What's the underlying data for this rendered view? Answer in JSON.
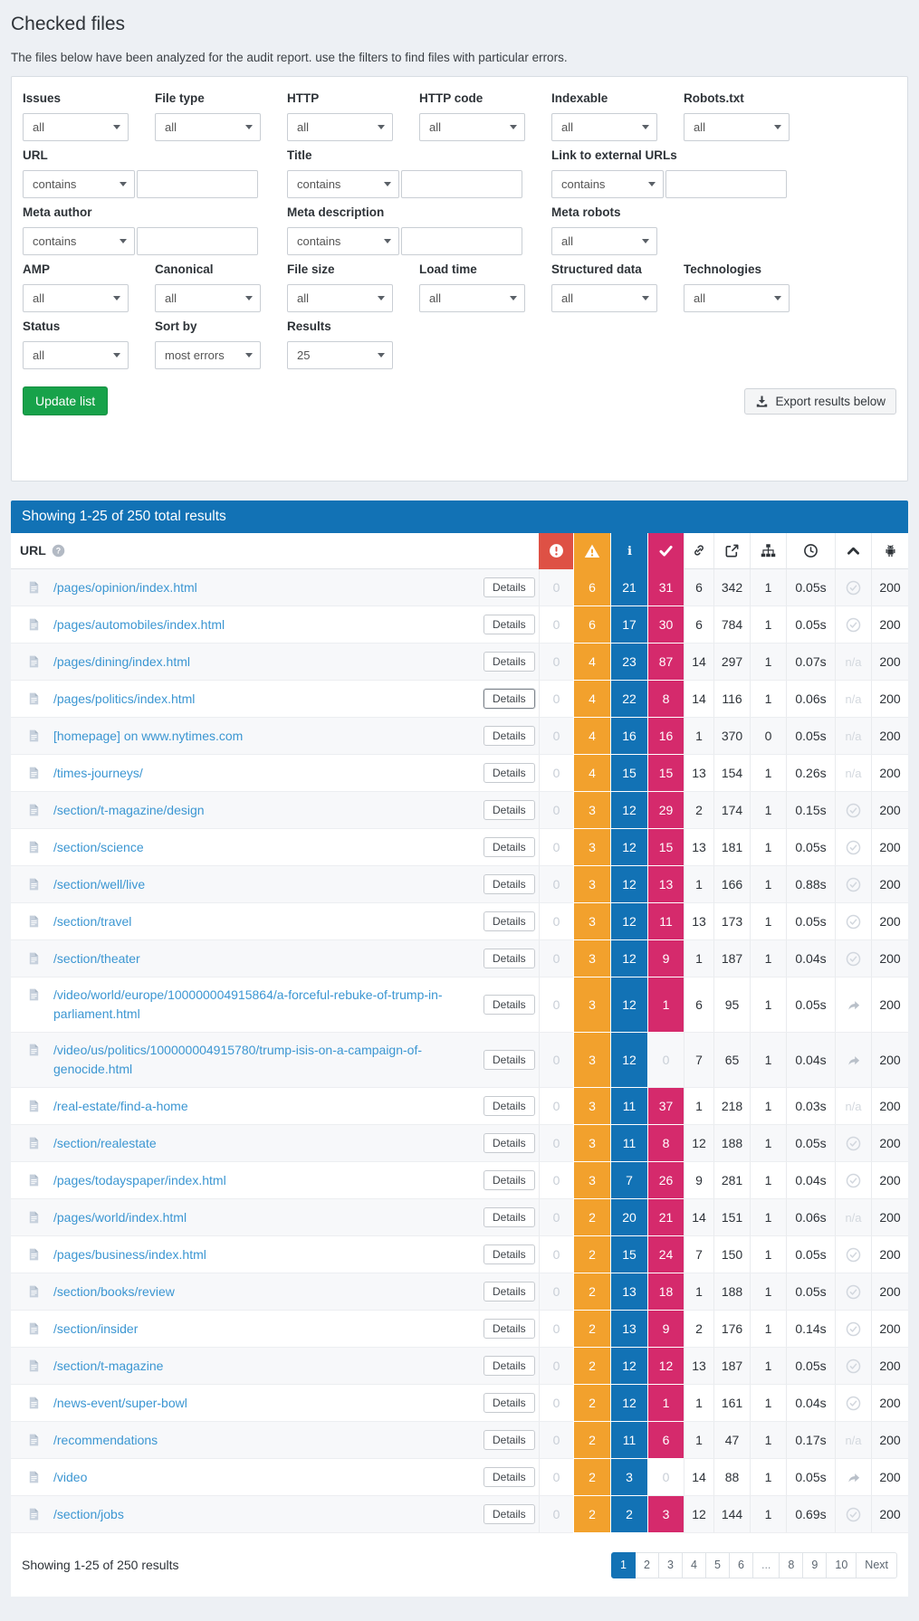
{
  "page": {
    "title": "Checked files",
    "subtitle": "The files below have been analyzed for the audit report. use the filters to find files with particular errors."
  },
  "filters": {
    "rows": [
      [
        {
          "kind": "select",
          "label": "Issues",
          "value": "all"
        },
        {
          "kind": "select",
          "label": "File type",
          "value": "all"
        },
        {
          "kind": "select",
          "label": "HTTP",
          "value": "all"
        },
        {
          "kind": "select",
          "label": "HTTP code",
          "value": "all"
        },
        {
          "kind": "select",
          "label": "Indexable",
          "value": "all"
        },
        {
          "kind": "select",
          "label": "Robots.txt",
          "value": "all"
        }
      ],
      [
        {
          "kind": "contains",
          "label": "URL",
          "value": "contains",
          "input": ""
        },
        {
          "kind": "contains",
          "label": "Title",
          "value": "contains",
          "input": ""
        },
        {
          "kind": "contains",
          "label": "Link to external URLs",
          "value": "contains",
          "input": ""
        }
      ],
      [
        {
          "kind": "contains",
          "label": "Meta author",
          "value": "contains",
          "input": ""
        },
        {
          "kind": "contains",
          "label": "Meta description",
          "value": "contains",
          "input": ""
        },
        {
          "kind": "select",
          "label": "Meta robots",
          "value": "all"
        }
      ],
      [
        {
          "kind": "select",
          "label": "AMP",
          "value": "all"
        },
        {
          "kind": "select",
          "label": "Canonical",
          "value": "all"
        },
        {
          "kind": "select",
          "label": "File size",
          "value": "all"
        },
        {
          "kind": "select",
          "label": "Load time",
          "value": "all"
        },
        {
          "kind": "select",
          "label": "Structured data",
          "value": "all"
        },
        {
          "kind": "select",
          "label": "Technologies",
          "value": "all"
        }
      ],
      [
        {
          "kind": "select",
          "label": "Status",
          "value": "all"
        },
        {
          "kind": "select",
          "label": "Sort by",
          "value": "most errors"
        },
        {
          "kind": "select",
          "label": "Results",
          "value": "25"
        }
      ]
    ]
  },
  "buttons": {
    "update": "Update list",
    "export": "Export results below"
  },
  "table": {
    "header_bar": "Showing 1-25 of 250 total results",
    "url_header": "URL",
    "details_label": "Details",
    "status_na": "n/a",
    "icon_columns": [
      "error",
      "warning",
      "info",
      "check",
      "links",
      "external-link",
      "sitemap",
      "load-time",
      "chevron-up",
      "android"
    ],
    "rows": [
      {
        "url": "/pages/opinion/index.html",
        "errors": 0,
        "warnings": 6,
        "info": 21,
        "check": 31,
        "links": 6,
        "external": 342,
        "sitemap": 1,
        "time": "0.05s",
        "status": "check",
        "code": 200
      },
      {
        "url": "/pages/automobiles/index.html",
        "errors": 0,
        "warnings": 6,
        "info": 17,
        "check": 30,
        "links": 6,
        "external": 784,
        "sitemap": 1,
        "time": "0.05s",
        "status": "check",
        "code": 200
      },
      {
        "url": "/pages/dining/index.html",
        "errors": 0,
        "warnings": 4,
        "info": 23,
        "check": 87,
        "links": 14,
        "external": 297,
        "sitemap": 1,
        "time": "0.07s",
        "status": "na",
        "code": 200
      },
      {
        "url": "/pages/politics/index.html",
        "errors": 0,
        "warnings": 4,
        "info": 22,
        "check": 8,
        "links": 14,
        "external": 116,
        "sitemap": 1,
        "time": "0.06s",
        "status": "na",
        "code": 200,
        "focused": true
      },
      {
        "url": "[homepage] on www.nytimes.com",
        "errors": 0,
        "warnings": 4,
        "info": 16,
        "check": 16,
        "links": 1,
        "external": 370,
        "sitemap": 0,
        "time": "0.05s",
        "status": "na",
        "code": 200
      },
      {
        "url": "/times-journeys/",
        "errors": 0,
        "warnings": 4,
        "info": 15,
        "check": 15,
        "links": 13,
        "external": 154,
        "sitemap": 1,
        "time": "0.26s",
        "status": "na",
        "code": 200
      },
      {
        "url": "/section/t-magazine/design",
        "errors": 0,
        "warnings": 3,
        "info": 12,
        "check": 29,
        "links": 2,
        "external": 174,
        "sitemap": 1,
        "time": "0.15s",
        "status": "check",
        "code": 200
      },
      {
        "url": "/section/science",
        "errors": 0,
        "warnings": 3,
        "info": 12,
        "check": 15,
        "links": 13,
        "external": 181,
        "sitemap": 1,
        "time": "0.05s",
        "status": "check",
        "code": 200
      },
      {
        "url": "/section/well/live",
        "errors": 0,
        "warnings": 3,
        "info": 12,
        "check": 13,
        "links": 1,
        "external": 166,
        "sitemap": 1,
        "time": "0.88s",
        "status": "check",
        "code": 200
      },
      {
        "url": "/section/travel",
        "errors": 0,
        "warnings": 3,
        "info": 12,
        "check": 11,
        "links": 13,
        "external": 173,
        "sitemap": 1,
        "time": "0.05s",
        "status": "check",
        "code": 200
      },
      {
        "url": "/section/theater",
        "errors": 0,
        "warnings": 3,
        "info": 12,
        "check": 9,
        "links": 1,
        "external": 187,
        "sitemap": 1,
        "time": "0.04s",
        "status": "check",
        "code": 200
      },
      {
        "url": "/video/world/europe/100000004915864/a-forceful-rebuke-of-trump-in-parliament.html",
        "errors": 0,
        "warnings": 3,
        "info": 12,
        "check": 1,
        "links": 6,
        "external": 95,
        "sitemap": 1,
        "time": "0.05s",
        "status": "redirect",
        "code": 200
      },
      {
        "url": "/video/us/politics/100000004915780/trump-isis-on-a-campaign-of-genocide.html",
        "errors": 0,
        "warnings": 3,
        "info": 12,
        "check": 0,
        "links": 7,
        "external": 65,
        "sitemap": 1,
        "time": "0.04s",
        "status": "redirect",
        "code": 200
      },
      {
        "url": "/real-estate/find-a-home",
        "errors": 0,
        "warnings": 3,
        "info": 11,
        "check": 37,
        "links": 1,
        "external": 218,
        "sitemap": 1,
        "time": "0.03s",
        "status": "na",
        "code": 200
      },
      {
        "url": "/section/realestate",
        "errors": 0,
        "warnings": 3,
        "info": 11,
        "check": 8,
        "links": 12,
        "external": 188,
        "sitemap": 1,
        "time": "0.05s",
        "status": "check",
        "code": 200
      },
      {
        "url": "/pages/todayspaper/index.html",
        "errors": 0,
        "warnings": 3,
        "info": 7,
        "check": 26,
        "links": 9,
        "external": 281,
        "sitemap": 1,
        "time": "0.04s",
        "status": "check",
        "code": 200
      },
      {
        "url": "/pages/world/index.html",
        "errors": 0,
        "warnings": 2,
        "info": 20,
        "check": 21,
        "links": 14,
        "external": 151,
        "sitemap": 1,
        "time": "0.06s",
        "status": "na",
        "code": 200
      },
      {
        "url": "/pages/business/index.html",
        "errors": 0,
        "warnings": 2,
        "info": 15,
        "check": 24,
        "links": 7,
        "external": 150,
        "sitemap": 1,
        "time": "0.05s",
        "status": "check",
        "code": 200
      },
      {
        "url": "/section/books/review",
        "errors": 0,
        "warnings": 2,
        "info": 13,
        "check": 18,
        "links": 1,
        "external": 188,
        "sitemap": 1,
        "time": "0.05s",
        "status": "check",
        "code": 200
      },
      {
        "url": "/section/insider",
        "errors": 0,
        "warnings": 2,
        "info": 13,
        "check": 9,
        "links": 2,
        "external": 176,
        "sitemap": 1,
        "time": "0.14s",
        "status": "check",
        "code": 200
      },
      {
        "url": "/section/t-magazine",
        "errors": 0,
        "warnings": 2,
        "info": 12,
        "check": 12,
        "links": 13,
        "external": 187,
        "sitemap": 1,
        "time": "0.05s",
        "status": "check",
        "code": 200
      },
      {
        "url": "/news-event/super-bowl",
        "errors": 0,
        "warnings": 2,
        "info": 12,
        "check": 1,
        "links": 1,
        "external": 161,
        "sitemap": 1,
        "time": "0.04s",
        "status": "check",
        "code": 200
      },
      {
        "url": "/recommendations",
        "errors": 0,
        "warnings": 2,
        "info": 11,
        "check": 6,
        "links": 1,
        "external": 47,
        "sitemap": 1,
        "time": "0.17s",
        "status": "na",
        "code": 200
      },
      {
        "url": "/video",
        "errors": 0,
        "warnings": 2,
        "info": 3,
        "check": 0,
        "links": 14,
        "external": 88,
        "sitemap": 1,
        "time": "0.05s",
        "status": "redirect",
        "code": 200
      },
      {
        "url": "/section/jobs",
        "errors": 0,
        "warnings": 2,
        "info": 2,
        "check": 3,
        "links": 12,
        "external": 144,
        "sitemap": 1,
        "time": "0.69s",
        "status": "check",
        "code": 200
      }
    ],
    "footer": "Showing 1-25 of 250 results",
    "pagination": [
      "1",
      "2",
      "3",
      "4",
      "5",
      "6",
      "...",
      "8",
      "9",
      "10",
      "Next"
    ],
    "active_page": "1"
  },
  "colors": {
    "header_blue": "#1272b5",
    "error_red": "#de5145",
    "warning_orange": "#f2a12d",
    "info_blue": "#1272b5",
    "check_pink": "#d52a6c",
    "update_green": "#17a24a",
    "link_blue": "#3b96d2"
  }
}
